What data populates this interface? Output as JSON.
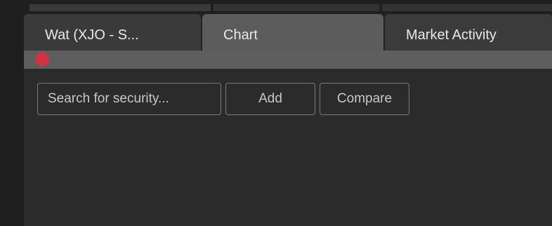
{
  "tabs": [
    {
      "label": "Wat (XJO - S..."
    },
    {
      "label": "Chart",
      "active": true
    },
    {
      "label": "Market Activity"
    }
  ],
  "status": {
    "indicator_color": "#d03345"
  },
  "toolbar": {
    "search_placeholder": "Search for security...",
    "add_label": "Add",
    "compare_label": "Compare"
  }
}
